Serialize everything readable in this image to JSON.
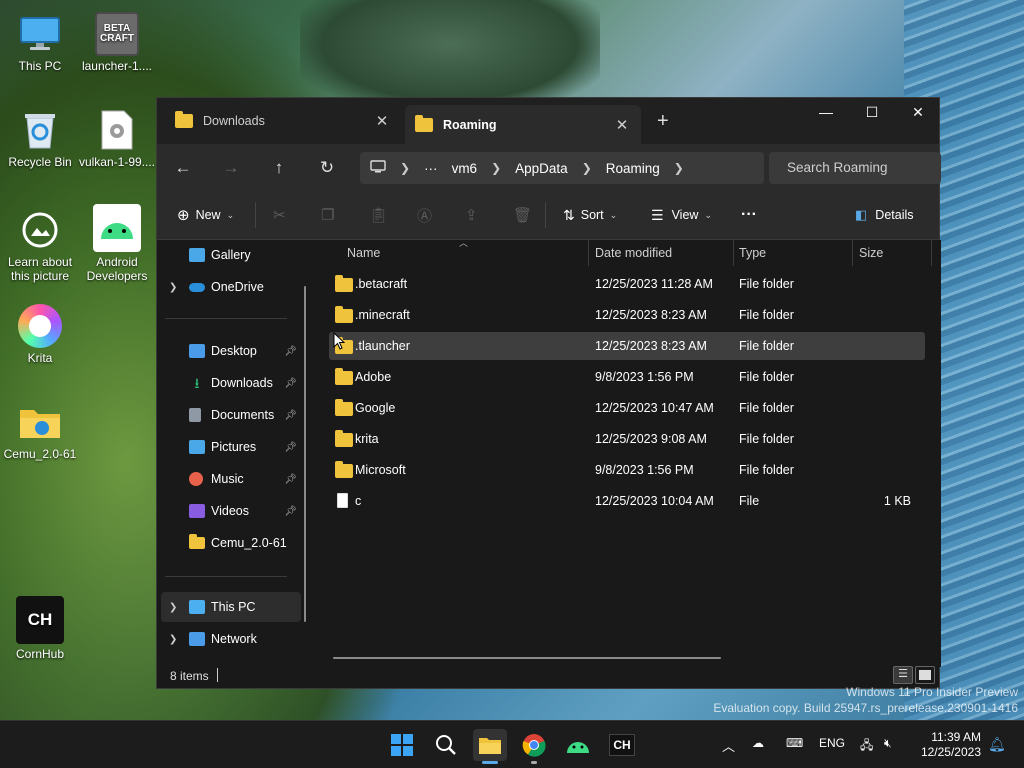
{
  "desktop": {
    "icons": [
      {
        "label": "This PC"
      },
      {
        "label": "launcher-1...."
      },
      {
        "label": "Recycle Bin"
      },
      {
        "label": "vulkan-1-99...."
      },
      {
        "label": "Learn about this picture"
      },
      {
        "label": "Android Developers"
      },
      {
        "label": "Krita"
      },
      {
        "label": "Cemu_2.0-61"
      },
      {
        "label": "CornHub"
      }
    ],
    "beta_badge": "BETA CRAFT",
    "ch_badge": "CH",
    "watermark_line1": "Windows 11 Pro Insider Preview",
    "watermark_line2": "Evaluation copy. Build 25947.rs_prerelease.230901-1416"
  },
  "window": {
    "tabs": [
      {
        "label": "Downloads",
        "active": false
      },
      {
        "label": "Roaming",
        "active": true
      }
    ],
    "new_tab": "+",
    "controls": {
      "minimize": "—",
      "maximize": "☐",
      "close": "✕"
    },
    "nav": {
      "back": "←",
      "forward": "→",
      "up": "↑",
      "refresh": "↻"
    },
    "breadcrumb": {
      "more": "···",
      "items": [
        "vm6",
        "AppData",
        "Roaming"
      ]
    },
    "search": {
      "placeholder": "Search Roaming"
    },
    "command_bar": {
      "new_label": "New",
      "sort_label": "Sort",
      "view_label": "View",
      "more": "···",
      "details_label": "Details"
    },
    "nav_pane": {
      "gallery": "Gallery",
      "onedrive": "OneDrive",
      "quick_access": [
        {
          "label": "Desktop",
          "color": "#4a9be8"
        },
        {
          "label": "Downloads",
          "color": "#2ec27e"
        },
        {
          "label": "Documents",
          "color": "#8f98a5"
        },
        {
          "label": "Pictures",
          "color": "#4aa8e8"
        },
        {
          "label": "Music",
          "color": "#e8614a"
        },
        {
          "label": "Videos",
          "color": "#8a5ce0"
        },
        {
          "label": "Cemu_2.0-61",
          "color": "#f0c33c"
        }
      ],
      "this_pc": "This PC",
      "network": "Network"
    },
    "columns": {
      "name": "Name",
      "date": "Date modified",
      "type": "Type",
      "size": "Size"
    },
    "files": [
      {
        "name": ".betacraft",
        "date": "12/25/2023 11:28 AM",
        "type": "File folder",
        "size": "",
        "kind": "folder"
      },
      {
        "name": ".minecraft",
        "date": "12/25/2023 8:23 AM",
        "type": "File folder",
        "size": "",
        "kind": "folder"
      },
      {
        "name": ".tlauncher",
        "date": "12/25/2023 8:23 AM",
        "type": "File folder",
        "size": "",
        "kind": "folder"
      },
      {
        "name": "Adobe",
        "date": "9/8/2023 1:56 PM",
        "type": "File folder",
        "size": "",
        "kind": "folder"
      },
      {
        "name": "Google",
        "date": "12/25/2023 10:47 AM",
        "type": "File folder",
        "size": "",
        "kind": "folder"
      },
      {
        "name": "krita",
        "date": "12/25/2023 9:08 AM",
        "type": "File folder",
        "size": "",
        "kind": "folder"
      },
      {
        "name": "Microsoft",
        "date": "9/8/2023 1:56 PM",
        "type": "File folder",
        "size": "",
        "kind": "folder"
      },
      {
        "name": "c",
        "date": "12/25/2023 10:04 AM",
        "type": "File",
        "size": "1 KB",
        "kind": "file"
      }
    ],
    "status": {
      "items_count": "8 items"
    }
  },
  "taskbar": {
    "lang": "ENG",
    "time": "11:39 AM",
    "date": "12/25/2023",
    "ch_label": "CH"
  }
}
